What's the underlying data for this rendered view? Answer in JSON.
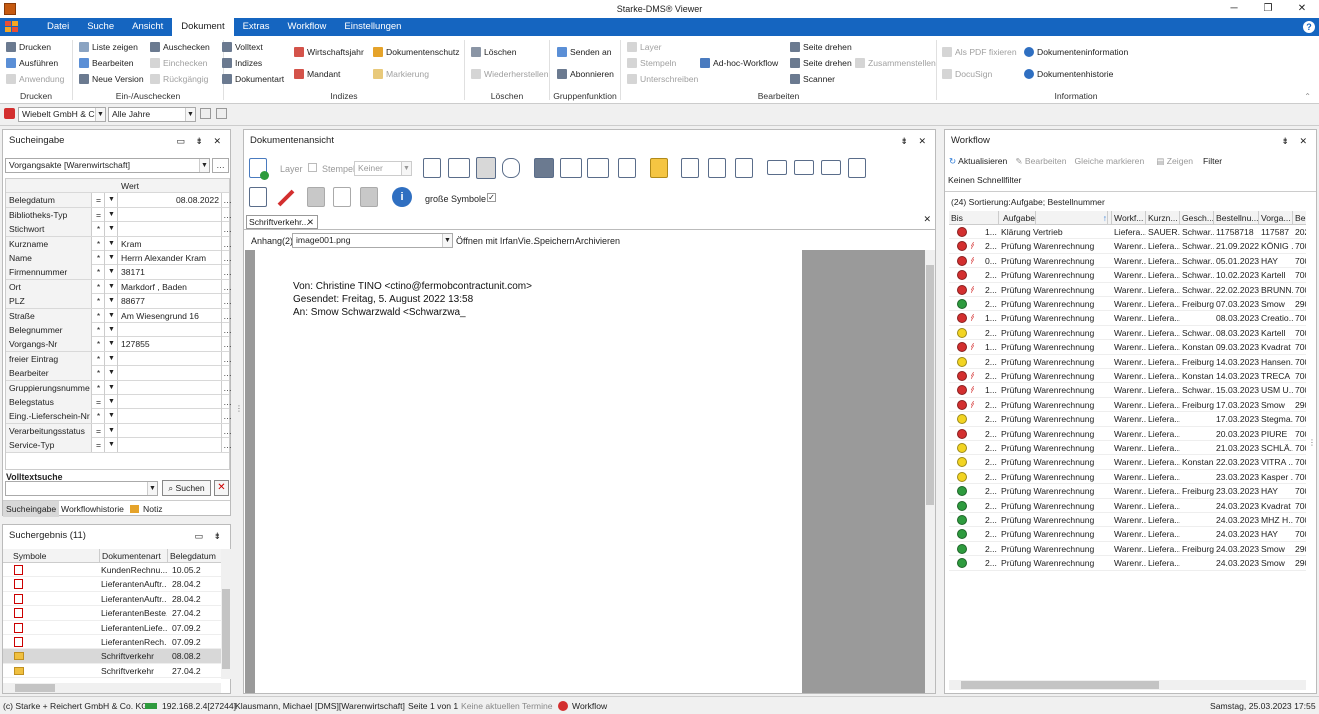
{
  "window": {
    "title": "Starke-DMS® Viewer"
  },
  "menu": {
    "tabs": [
      "Datei",
      "Suche",
      "Ansicht",
      "Dokument",
      "Extras",
      "Workflow",
      "Einstellungen"
    ],
    "active": "Dokument"
  },
  "ribbon": {
    "drucken": {
      "label": "Drucken",
      "items": [
        "Drucken",
        "Ausführen",
        "Anwendung"
      ]
    },
    "einaus": {
      "label": "Ein-/Auschecken",
      "items": [
        "Liste zeigen",
        "Bearbeiten",
        "Neue Version",
        "Auschecken",
        "Einchecken",
        "Rückgängig"
      ]
    },
    "indizes": {
      "label": "Indizes",
      "items": [
        "Volltext",
        "Indizes",
        "Dokumentart",
        "Wirtschaftsjahr",
        "Mandant",
        "Dokumentenschutz",
        "Markierung"
      ]
    },
    "loeschen": {
      "label": "Löschen",
      "items": [
        "Löschen",
        "Wiederherstellen"
      ]
    },
    "gruppen": {
      "label": "Gruppenfunktion",
      "items": [
        "Senden an",
        "Abonnieren"
      ]
    },
    "bearbeiten": {
      "label": "Bearbeiten",
      "items": [
        "Layer",
        "Stempeln",
        "Unterschreiben",
        "Ad-hoc-Workflow",
        "Seite drehen",
        "Seite drehen",
        "Scanner",
        "Zusammenstellen"
      ]
    },
    "information": {
      "label": "Information",
      "items": [
        "Als PDF fixieren",
        "DocuSign",
        "Dokumenteninformation",
        "Dokumentenhistorie"
      ]
    }
  },
  "context": {
    "mandant": "Wiebelt GmbH & Co",
    "jahr": "Alle Jahre"
  },
  "sucheingabe": {
    "title": "Sucheingabe",
    "akte": "Vorgangsakte [Warenwirtschaft]",
    "col_wert": "Wert",
    "fields": [
      {
        "name": "Belegdatum",
        "op": "=",
        "wert": "08.08.2022"
      },
      {
        "name": "Bibliotheks-Typ",
        "op": "=",
        "wert": ""
      },
      {
        "name": "Stichwort",
        "op": "*",
        "wert": ""
      },
      {
        "name": "Kurzname",
        "op": "*",
        "wert": "Kram"
      },
      {
        "name": "Name",
        "op": "*",
        "wert": "Herrn Alexander Kram"
      },
      {
        "name": "Firmennummer",
        "op": "*",
        "wert": "38171"
      },
      {
        "name": "Ort",
        "op": "*",
        "wert": "Markdorf , Baden"
      },
      {
        "name": "PLZ",
        "op": "*",
        "wert": "88677"
      },
      {
        "name": "Straße",
        "op": "*",
        "wert": "Am Wiesengrund 16"
      },
      {
        "name": "Belegnummer",
        "op": "*",
        "wert": ""
      },
      {
        "name": "Vorgangs-Nr",
        "op": "*",
        "wert": "127855"
      },
      {
        "name": "freier Eintrag",
        "op": "*",
        "wert": ""
      },
      {
        "name": "Bearbeiter",
        "op": "*",
        "wert": ""
      },
      {
        "name": "Gruppierungsnumme",
        "op": "*",
        "wert": ""
      },
      {
        "name": "Belegstatus",
        "op": "=",
        "wert": ""
      },
      {
        "name": "Eing.-Lieferschein-Nr",
        "op": "*",
        "wert": ""
      },
      {
        "name": "Verarbeitungsstatus",
        "op": "=",
        "wert": ""
      },
      {
        "name": "Service-Typ",
        "op": "=",
        "wert": ""
      }
    ],
    "volltext_label": "Volltextsuche",
    "suchen": "Suchen",
    "tabs": [
      "Sucheingabe",
      "Workflowhistorie",
      "Notiz"
    ]
  },
  "suchergebnis": {
    "title": "Suchergebnis (11)",
    "cols": [
      "Symbole",
      "Dokumentenart",
      "Belegdatum"
    ],
    "rows": [
      {
        "art": "KundenRechnu...",
        "datum": "10.05.2",
        "icon": "pdf"
      },
      {
        "art": "LieferantenAuftr...",
        "datum": "28.04.2",
        "icon": "pdf"
      },
      {
        "art": "LieferantenAuftr...",
        "datum": "28.04.2",
        "icon": "pdf"
      },
      {
        "art": "LieferantenBeste...",
        "datum": "27.04.2",
        "icon": "pdf"
      },
      {
        "art": "LieferantenLiefe...",
        "datum": "07.09.2",
        "icon": "pdf"
      },
      {
        "art": "LieferantenRech...",
        "datum": "07.09.2",
        "icon": "pdf"
      },
      {
        "art": "Schriftverkehr",
        "datum": "08.08.2",
        "icon": "folder"
      },
      {
        "art": "Schriftverkehr",
        "datum": "27.04.2",
        "icon": "folder"
      }
    ]
  },
  "dokumentansicht": {
    "title": "Dokumentenansicht",
    "layer": "Layer",
    "stempel": "Stempel",
    "stempel_value": "Keiner",
    "grosse_symbole": "große Symbole",
    "tab": "Schriftverkehr...",
    "anhang_label": "Anhang(2)",
    "anhang_value": "image001.png",
    "links": [
      "Öffnen mit IrfanVie..",
      "Speichern",
      "Archivieren"
    ],
    "email": [
      "Von: Christine TINO <ctino@fermobcontractunit.com>",
      "Gesendet: Freitag, 5. August 2022 13:58",
      "An: Smow Schwarzwald <Schwarzwa_"
    ]
  },
  "workflow": {
    "title": "Workflow",
    "actions": [
      "Aktualisieren",
      "Bearbeiten",
      "Gleiche markieren",
      "Zeigen",
      "Filter"
    ],
    "sub": [
      "Keinen",
      "Schnellfilter"
    ],
    "sort": "(24) Sortierung:Aufgabe; Bestellnummer",
    "cols": [
      "Bis",
      "Aufgabe",
      "Workf...",
      "Kurzn...",
      "Gesch...",
      "Bestellnu...",
      "Vorga...",
      "Bel"
    ],
    "rows": [
      {
        "c": "#d32f2f",
        "bis": "1...",
        "auf": "Klärung Vertrieb",
        "wf": "Liefera...",
        "kn": "SAUER...",
        "ge": "Schwar...",
        "bn": "11758718",
        "vg": "117587",
        "be": "202",
        "flag": false
      },
      {
        "c": "#d32f2f",
        "bis": "2...",
        "auf": "Prüfung Warenrechnung",
        "wf": "Warenr...",
        "kn": "Liefera...",
        "ge": "Schwar...",
        "bn": "21.09.2022",
        "vg": "KÖNIG ...",
        "be": "700",
        "flag": true
      },
      {
        "c": "#d32f2f",
        "bis": "0...",
        "auf": "Prüfung Warenrechnung",
        "wf": "Warenr...",
        "kn": "Liefera...",
        "ge": "Schwar...",
        "bn": "05.01.2023",
        "vg": "HAY",
        "be": "700",
        "flag": true
      },
      {
        "c": "#d32f2f",
        "bis": "2...",
        "auf": "Prüfung Warenrechnung",
        "wf": "Warenr...",
        "kn": "Liefera...",
        "ge": "Schwar...",
        "bn": "10.02.2023",
        "vg": "Kartell",
        "be": "700",
        "flag": false
      },
      {
        "c": "#d32f2f",
        "bis": "2...",
        "auf": "Prüfung Warenrechnung",
        "wf": "Warenr...",
        "kn": "Liefera...",
        "ge": "Schwar...",
        "bn": "22.02.2023",
        "vg": "BRUNN...",
        "be": "700",
        "flag": true
      },
      {
        "c": "#2e9b3e",
        "bis": "2...",
        "auf": "Prüfung Warenrechnung",
        "wf": "Warenr...",
        "kn": "Liefera...",
        "ge": "Freiburg",
        "bn": "07.03.2023",
        "vg": "Smow",
        "be": "290",
        "flag": false
      },
      {
        "c": "#d32f2f",
        "bis": "1...",
        "auf": "Prüfung Warenrechnung",
        "wf": "Warenr...",
        "kn": "Liefera...",
        "ge": "",
        "bn": "08.03.2023",
        "vg": "Creatio...",
        "be": "700",
        "flag": true
      },
      {
        "c": "#f2d422",
        "bis": "2...",
        "auf": "Prüfung Warenrechnung",
        "wf": "Warenr...",
        "kn": "Liefera...",
        "ge": "Schwar...",
        "bn": "08.03.2023",
        "vg": "Kartell",
        "be": "700",
        "flag": false
      },
      {
        "c": "#d32f2f",
        "bis": "1...",
        "auf": "Prüfung Warenrechnung",
        "wf": "Warenr...",
        "kn": "Liefera...",
        "ge": "Konstanz",
        "bn": "09.03.2023",
        "vg": "Kvadrat",
        "be": "700",
        "flag": true
      },
      {
        "c": "#f2d422",
        "bis": "2...",
        "auf": "Prüfung Warenrechnung",
        "wf": "Warenr...",
        "kn": "Liefera...",
        "ge": "Freiburg",
        "bn": "14.03.2023",
        "vg": "Hansen...",
        "be": "700",
        "flag": false
      },
      {
        "c": "#d32f2f",
        "bis": "2...",
        "auf": "Prüfung Warenrechnung",
        "wf": "Warenr...",
        "kn": "Liefera...",
        "ge": "Konstanz",
        "bn": "14.03.2023",
        "vg": "TRECA",
        "be": "700",
        "flag": true
      },
      {
        "c": "#d32f2f",
        "bis": "1...",
        "auf": "Prüfung Warenrechnung",
        "wf": "Warenr...",
        "kn": "Liefera...",
        "ge": "Schwar...",
        "bn": "15.03.2023",
        "vg": "USM U...",
        "be": "700",
        "flag": true
      },
      {
        "c": "#d32f2f",
        "bis": "2...",
        "auf": "Prüfung Warenrechnung",
        "wf": "Warenr...",
        "kn": "Liefera...",
        "ge": "Freiburg",
        "bn": "17.03.2023",
        "vg": "Smow",
        "be": "290",
        "flag": true
      },
      {
        "c": "#f2d422",
        "bis": "2...",
        "auf": "Prüfung Warenrechnung",
        "wf": "Warenr...",
        "kn": "Liefera...",
        "ge": "",
        "bn": "17.03.2023",
        "vg": "Stegma...",
        "be": "700",
        "flag": false
      },
      {
        "c": "#d32f2f",
        "bis": "2...",
        "auf": "Prüfung Warenrechnung",
        "wf": "Warenr...",
        "kn": "Liefera...",
        "ge": "",
        "bn": "20.03.2023",
        "vg": "PIURE",
        "be": "700",
        "flag": false
      },
      {
        "c": "#f2d422",
        "bis": "2...",
        "auf": "Prüfung Warenrechnung",
        "wf": "Warenr...",
        "kn": "Liefera...",
        "ge": "",
        "bn": "21.03.2023",
        "vg": "SCHLÄ...",
        "be": "700",
        "flag": false
      },
      {
        "c": "#f2d422",
        "bis": "2...",
        "auf": "Prüfung Warenrechnung",
        "wf": "Warenr...",
        "kn": "Liefera...",
        "ge": "Konstanz",
        "bn": "22.03.2023",
        "vg": "VITRA ...",
        "be": "700",
        "flag": false
      },
      {
        "c": "#f2d422",
        "bis": "2...",
        "auf": "Prüfung Warenrechnung",
        "wf": "Warenr...",
        "kn": "Liefera...",
        "ge": "",
        "bn": "23.03.2023",
        "vg": "Kasper ...",
        "be": "700",
        "flag": false
      },
      {
        "c": "#2e9b3e",
        "bis": "2...",
        "auf": "Prüfung Warenrechnung",
        "wf": "Warenr...",
        "kn": "Liefera...",
        "ge": "Freiburg",
        "bn": "23.03.2023",
        "vg": "HAY",
        "be": "700",
        "flag": false
      },
      {
        "c": "#2e9b3e",
        "bis": "2...",
        "auf": "Prüfung Warenrechnung",
        "wf": "Warenr...",
        "kn": "Liefera...",
        "ge": "",
        "bn": "24.03.2023",
        "vg": "Kvadrat",
        "be": "700",
        "flag": false
      },
      {
        "c": "#2e9b3e",
        "bis": "2...",
        "auf": "Prüfung Warenrechnung",
        "wf": "Warenr...",
        "kn": "Liefera...",
        "ge": "",
        "bn": "24.03.2023",
        "vg": "MHZ H...",
        "be": "700",
        "flag": false
      },
      {
        "c": "#2e9b3e",
        "bis": "2...",
        "auf": "Prüfung Warenrechnung",
        "wf": "Warenr...",
        "kn": "Liefera...",
        "ge": "",
        "bn": "24.03.2023",
        "vg": "HAY",
        "be": "700",
        "flag": false
      },
      {
        "c": "#2e9b3e",
        "bis": "2...",
        "auf": "Prüfung Warenrechnung",
        "wf": "Warenr...",
        "kn": "Liefera...",
        "ge": "Freiburg",
        "bn": "24.03.2023",
        "vg": "Smow",
        "be": "290",
        "flag": false
      },
      {
        "c": "#2e9b3e",
        "bis": "2...",
        "auf": "Prüfung Warenrechnung",
        "wf": "Warenr...",
        "kn": "Liefera...",
        "ge": "",
        "bn": "24.03.2023",
        "vg": "Smow",
        "be": "290",
        "flag": false
      }
    ]
  },
  "statusbar": {
    "company": "(c) Starke + Reichert GmbH & Co. KG",
    "ip": "192.168.2.4[27244]",
    "user": "Klausmann, Michael",
    "db": "[DMS][Warenwirtschaft]",
    "page": "Seite 1 von 1",
    "termine": "Keine aktuellen Termine",
    "workflow": "Workflow",
    "datetime": "Samstag, 25.03.2023 17:55"
  }
}
